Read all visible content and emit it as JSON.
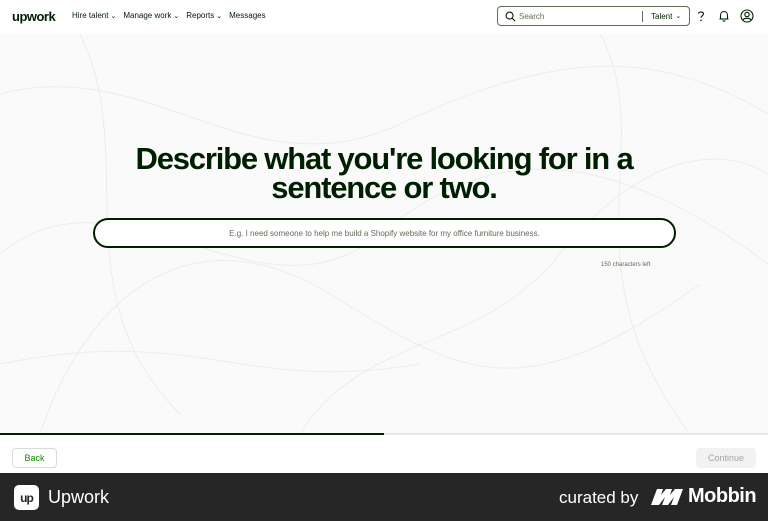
{
  "header": {
    "logo": "upwork",
    "nav": [
      {
        "label": "Hire talent",
        "has_dropdown": true
      },
      {
        "label": "Manage work",
        "has_dropdown": true
      },
      {
        "label": "Reports",
        "has_dropdown": true
      },
      {
        "label": "Messages",
        "has_dropdown": false
      }
    ],
    "search": {
      "placeholder": "Search",
      "value": "",
      "type_label": "Talent"
    },
    "icons": [
      "help-icon",
      "notification-bell-icon",
      "user-avatar-icon"
    ]
  },
  "main": {
    "headline": "Describe what you're looking for in a sentence or two.",
    "description": {
      "placeholder": "E.g. I need someone to help me build a Shopify website for my office furniture business.",
      "value": ""
    },
    "char_count": "150 characters left",
    "progress": 0.5
  },
  "actions": {
    "back_label": "Back",
    "continue_label": "Continue",
    "continue_disabled": true
  },
  "footer": {
    "logo_mark": "up",
    "brand": "Upwork",
    "curated_label": "curated by",
    "mobbin_label": "Mobbin"
  },
  "colors": {
    "brand_green": "#108a00",
    "text_dark": "#001e00",
    "footer_bg": "#262626",
    "border": "#5e6d55"
  }
}
